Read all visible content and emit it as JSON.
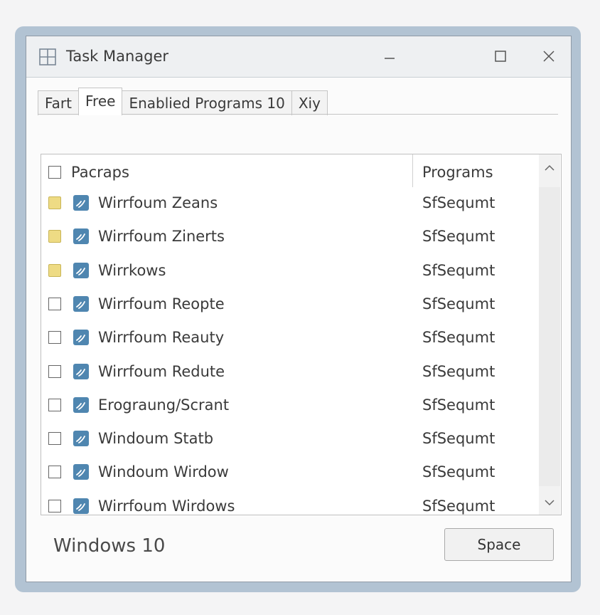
{
  "window": {
    "title": "Task Manager"
  },
  "titlebar": {
    "icons": [
      "windows-logo-icon",
      "minimize-icon",
      "maximize-icon",
      "close-icon"
    ]
  },
  "tabs": [
    {
      "label": "Fart",
      "active": false
    },
    {
      "label": "Free",
      "active": true
    },
    {
      "label": "Enablied Programs 10",
      "active": false
    },
    {
      "label": "Xiy",
      "active": false
    }
  ],
  "list": {
    "columns": [
      "Pacraps",
      "Programs"
    ],
    "rows": [
      {
        "name": "Wirrfoum Zeans",
        "program": "SfSequmt",
        "checkbox": "yellow"
      },
      {
        "name": "Wirrfoum Zinerts",
        "program": "SfSequmt",
        "checkbox": "yellow"
      },
      {
        "name": "Wirrkows",
        "program": "SfSequmt",
        "checkbox": "yellow"
      },
      {
        "name": "Wirrfoum Reopte",
        "program": "SfSequmt",
        "checkbox": "empty"
      },
      {
        "name": "Wirrfoum Reauty",
        "program": "SfSequmt",
        "checkbox": "empty"
      },
      {
        "name": "Wirrfoum Redute",
        "program": "SfSequmt",
        "checkbox": "empty"
      },
      {
        "name": "Erograung/Scrant",
        "program": "SfSequmt",
        "checkbox": "empty"
      },
      {
        "name": "Windoum Statb",
        "program": "SfSequmt",
        "checkbox": "empty"
      },
      {
        "name": "Windoum Wirdow",
        "program": "SfSequmt",
        "checkbox": "empty"
      },
      {
        "name": "Wirrfoum Wirdows",
        "program": "SfSequmt",
        "checkbox": "empty"
      }
    ]
  },
  "footer": {
    "status": "Windows 10",
    "button_label": "Space"
  },
  "colors": {
    "frame": "#b2c3d3",
    "app_icon": "#4f86b0",
    "yellow_box": "#eedb84"
  }
}
